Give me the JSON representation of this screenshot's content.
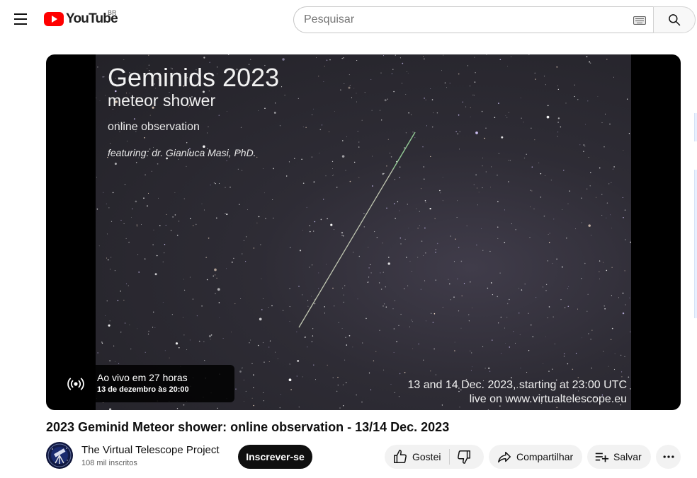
{
  "header": {
    "logo_text": "YouTube",
    "country_code": "BR",
    "search_placeholder": "Pesquisar"
  },
  "player": {
    "thumbnail": {
      "title": "Geminids 2023",
      "subtitle": "meteor shower",
      "line1": "online observation",
      "featuring": "featuring: dr. Gianluca Masi, PhD.",
      "dates": "13 and 14 Dec. 2023, starting at 23:00 UTC",
      "url": "live on www.virtualtelescope.eu"
    },
    "live_badge": {
      "main": "Ao vivo em 27 horas",
      "sub": "13 de dezembro às 20:00"
    }
  },
  "video": {
    "title": "2023 Geminid Meteor shower: online observation - 13/14 Dec. 2023"
  },
  "channel": {
    "name": "The Virtual Telescope Project",
    "subscribers": "108 mil inscritos",
    "subscribe_label": "Inscrever-se"
  },
  "actions": {
    "like_label": "Gostei",
    "share_label": "Compartilhar",
    "save_label": "Salvar"
  },
  "icons": {
    "menu": "hamburger-menu-icon",
    "search": "search-icon",
    "keyboard": "keyboard-icon",
    "live": "live-broadcast-icon",
    "like": "thumbs-up-icon",
    "dislike": "thumbs-down-icon",
    "share": "share-arrow-icon",
    "save": "playlist-add-icon",
    "more": "more-horizontal-icon"
  },
  "colors": {
    "brand_red": "#ff0000",
    "subscribe_bg": "#0f0f0f",
    "pill_bg": "#f2f2f2"
  }
}
